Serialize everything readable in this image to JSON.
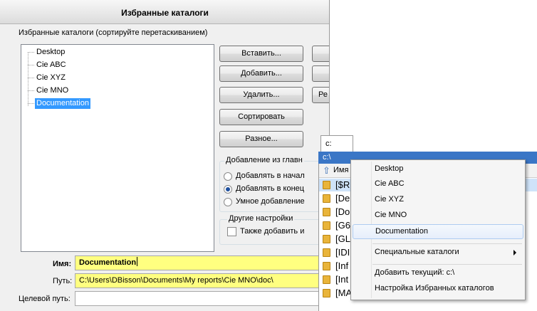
{
  "dialog": {
    "title": "Избранные каталоги",
    "group_caption": "Избранные каталоги (сортируйте перетаскиванием)",
    "tree_items": [
      {
        "label": "Desktop",
        "selected": false
      },
      {
        "label": "Cie ABC",
        "selected": false
      },
      {
        "label": "Cie XYZ",
        "selected": false
      },
      {
        "label": "Cie MNO",
        "selected": false
      },
      {
        "label": "Documentation",
        "selected": true
      }
    ],
    "buttons": {
      "insert": "Вставить...",
      "add": "Добавить...",
      "delete": "Удалить...",
      "sort": "Сортировать",
      "misc": "Разное... ",
      "right_partial": "Ре"
    },
    "add_group": {
      "caption": "Добавление из главн",
      "options": [
        {
          "label": "Добавлять в начал",
          "checked": false
        },
        {
          "label": "Добавлять в конец",
          "checked": true
        },
        {
          "label": "Умное добавление",
          "checked": false
        }
      ]
    },
    "other_group": {
      "caption": "Другие настройки",
      "checkbox_label": "Также добавить и",
      "checkbox_checked": false
    },
    "fields": {
      "name_label": "Имя:",
      "name_value": "Documentation",
      "path_label": "Путь:",
      "path_value": "C:\\Users\\DBisson\\Documents\\My reports\\Cie MNO\\doc\\",
      "target_label": "Целевой путь:",
      "target_value": ""
    }
  },
  "explorer": {
    "tab_label": "c:",
    "path": "c:\\",
    "header_name": "Имя",
    "rows": [
      {
        "name": "[$R",
        "selected": true
      },
      {
        "name": "[De",
        "selected": false
      },
      {
        "name": "[Do",
        "selected": false
      },
      {
        "name": "[G6",
        "selected": false
      },
      {
        "name": "[GL",
        "selected": false
      },
      {
        "name": "[IDI",
        "selected": false
      },
      {
        "name": "[Inf",
        "selected": false
      },
      {
        "name": "[Int",
        "selected": false
      },
      {
        "name": "[MAME_for_Go]",
        "selected": false
      }
    ]
  },
  "context_menu": {
    "items": [
      {
        "label": "Desktop"
      },
      {
        "label": "Cie ABC"
      },
      {
        "label": "Cie XYZ"
      },
      {
        "label": "Cie MNO"
      },
      {
        "label": "Documentation"
      }
    ],
    "special_label": "Специальные каталоги",
    "add_current_label": "Добавить текущий: c:\\",
    "configure_label": "Настройка Избранных каталогов"
  },
  "colors": {
    "selection": "#3399ff",
    "highlight_field": "#ffff80",
    "path_bar": "#3a76c6"
  }
}
